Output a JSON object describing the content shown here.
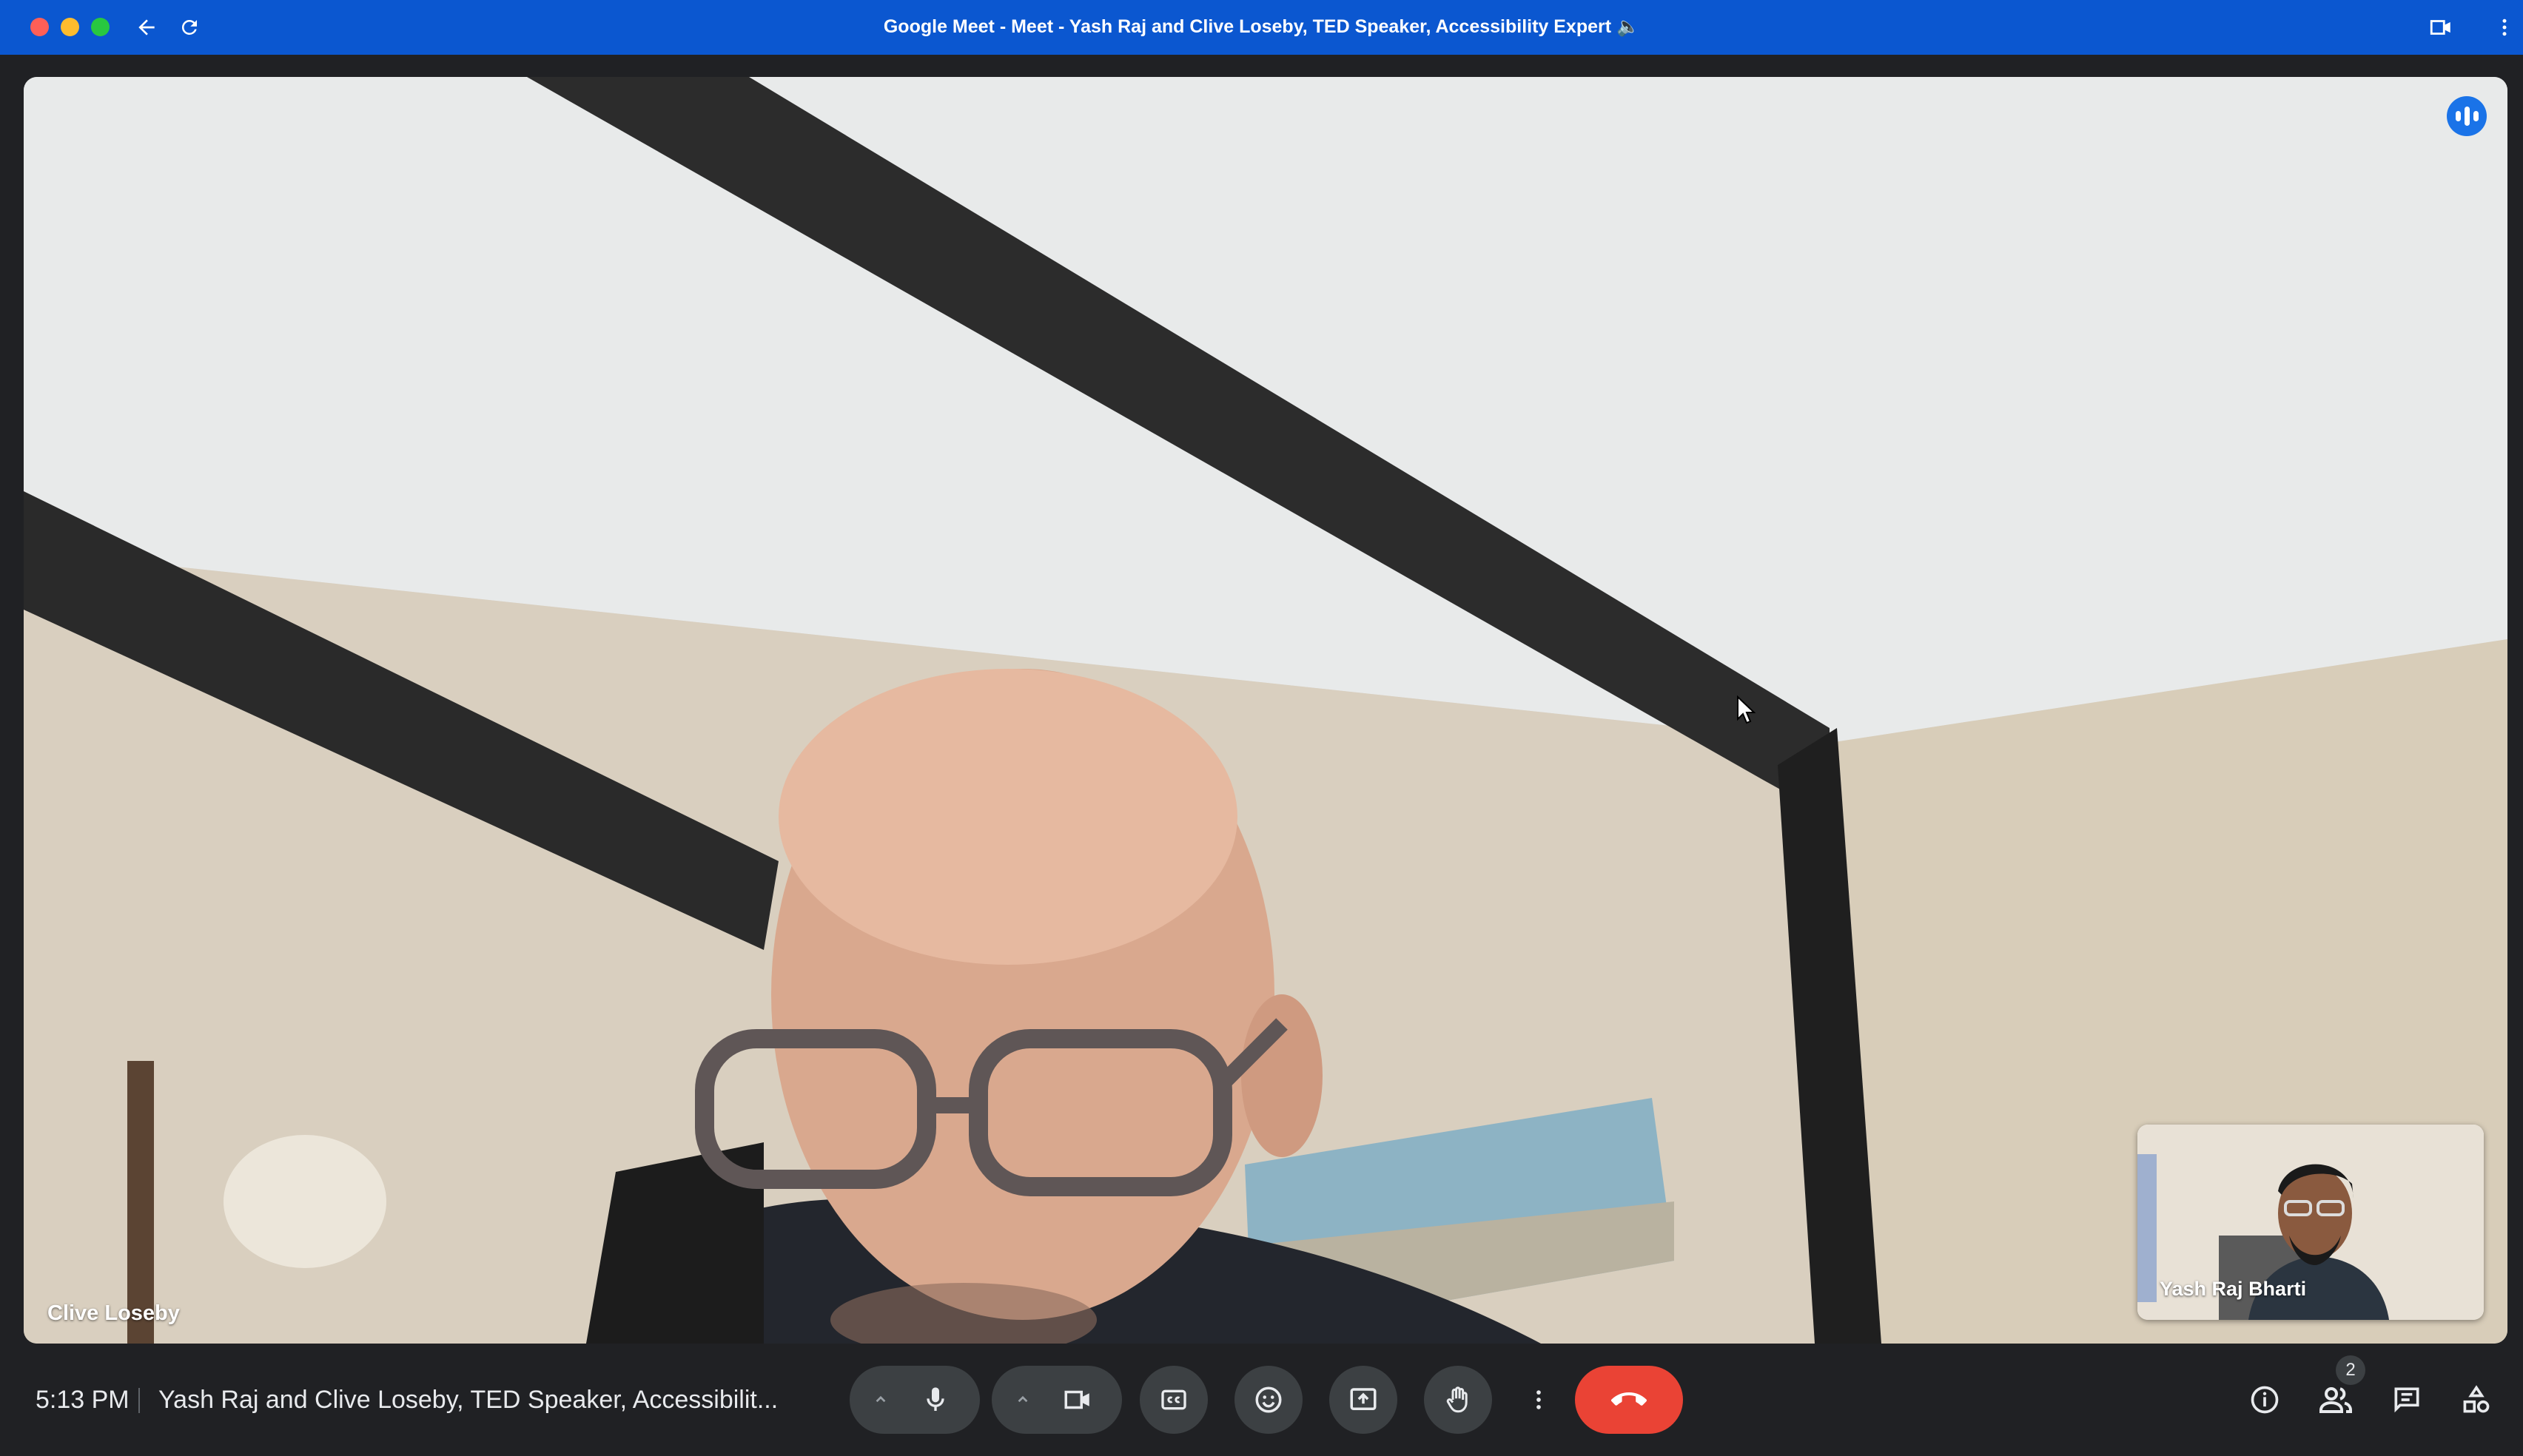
{
  "window": {
    "title": "Google Meet - Meet - Yash Raj and Clive Loseby, TED Speaker, Accessibility Expert 🔈"
  },
  "main_video": {
    "participant_name": "Clive Loseby"
  },
  "self_view": {
    "participant_name": "Yash Raj Bharti"
  },
  "bottom_bar": {
    "time": "5:13 PM",
    "meeting_title": "Yash Raj and Clive Loseby, TED Speaker, Accessibilit...",
    "participant_count": "2"
  },
  "icons": {
    "back": "arrow-left-icon",
    "reload": "reload-icon",
    "camera": "video-camera-icon",
    "more": "more-vertical-icon",
    "mic": "microphone-icon",
    "captions": "closed-captions-icon",
    "emoji": "emoji-icon",
    "present": "present-screen-icon",
    "raise_hand": "raise-hand-icon",
    "end_call": "end-call-icon",
    "info": "info-icon",
    "people": "people-icon",
    "chat": "chat-icon",
    "activities": "activities-icon"
  },
  "colors": {
    "titlebar": "#0b57d0",
    "end_call": "#ea4335",
    "control_bg": "#3c4043",
    "speaking": "#1a73e8"
  }
}
